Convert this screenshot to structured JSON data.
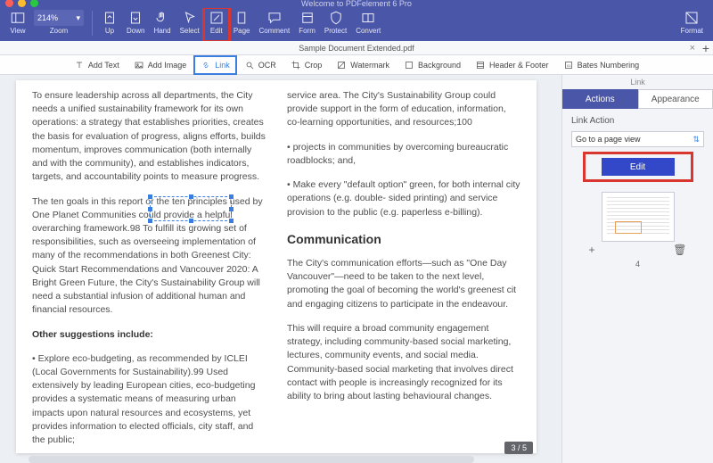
{
  "app_title": "Welcome to PDFelement 6 Pro",
  "zoom": {
    "value": "214%",
    "label": "Zoom"
  },
  "toolbar": {
    "view": "View",
    "up": "Up",
    "down": "Down",
    "hand": "Hand",
    "select": "Select",
    "edit": "Edit",
    "page": "Page",
    "comment": "Comment",
    "form": "Form",
    "protect": "Protect",
    "convert": "Convert",
    "format": "Format"
  },
  "doc_tab": {
    "name": "Sample Document Extended.pdf"
  },
  "subbar": {
    "add_text": "Add Text",
    "add_image": "Add Image",
    "link": "Link",
    "ocr": "OCR",
    "crop": "Crop",
    "watermark": "Watermark",
    "background": "Background",
    "header_footer": "Header & Footer",
    "bates": "Bates Numbering"
  },
  "page_indicator": "3 / 5",
  "doc": {
    "left": {
      "p1": "To ensure leadership across all departments, the City needs a unified sustainability framework for its own operations: a strategy that establishes priorities, creates the basis for evaluation of progress, aligns efforts, builds momentum, improves communication (both internally and with the community), and establishes indicators, targets, and accountability points to measure progress.",
      "p2": "The ten goals in this report or the ten principles used by One Planet Communities could provide a helpful overarching framework.98 To fulfill its growing set of responsibilities, such as overseeing implementation of many of the recommendations in both Greenest City: Quick Start Recommendations and Vancouver 2020: A Bright Green Future, the City's Sustainability Group will need a substantial infusion of additional human and financial resources.",
      "h": "Other suggestions include:",
      "p3": "• Explore eco-budgeting, as recommended by ICLEI (Local Governments for Sustainability).99 Used extensively by leading European cities, eco-budgeting provides a systematic means of measuring urban impacts upon natural resources and ecosystems, yet provides information to elected officials, city staff, and the public;"
    },
    "right": {
      "p1": "service area. The City's Sustainability Group could provide support in the form of education, information, co-learning opportunities, and resources;100",
      "p2": "• projects in communities by overcoming bureaucratic roadblocks; and,",
      "p3": "• Make every \"default option\" green, for both internal city operations (e.g. double- sided printing) and service provision to the public (e.g. paperless e-billing).",
      "h": "Communication",
      "p4": "The City's communication efforts—such as \"One Day Vancouver\"—need to be taken to the next level, promoting the goal of becoming the world's greenest cit and engaging citizens to participate in the endeavour.",
      "p5": "This will require a broad community engagement strategy, including community-based social marketing, lectures, community events, and social media. Community-based social marketing that involves direct contact with people is increasingly recognized for its ability to bring about lasting behavioural changes."
    }
  },
  "panel": {
    "title": "Link",
    "tab_actions": "Actions",
    "tab_appearance": "Appearance",
    "section": "Link Action",
    "dropdown": "Go to a page view",
    "edit_button": "Edit",
    "thumb_label": "4"
  }
}
